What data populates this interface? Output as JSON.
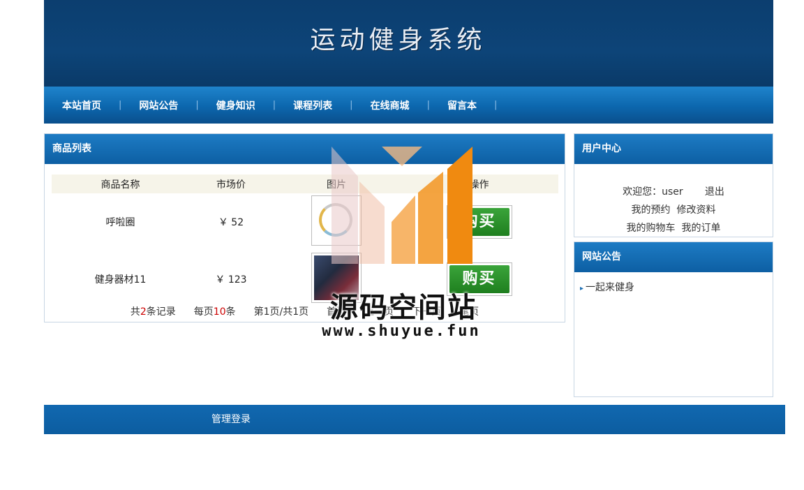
{
  "header": {
    "title": "运动健身系统"
  },
  "nav": {
    "items": [
      "本站首页",
      "网站公告",
      "健身知识",
      "课程列表",
      "在线商城",
      "留言本"
    ]
  },
  "goods_panel": {
    "title": "商品列表",
    "columns": [
      "商品名称",
      "市场价",
      "图片",
      "操作"
    ],
    "rows": [
      {
        "name": "呼啦圈",
        "price": "￥ 52",
        "buy": "购买"
      },
      {
        "name": "健身器材11",
        "price": "￥ 123",
        "buy": "购买"
      }
    ],
    "pager": {
      "total_prefix": "共",
      "total": "2",
      "total_suffix": "条记录",
      "per_prefix": "每页",
      "per": "10",
      "per_suffix": "条",
      "page_info": "第1页/共1页",
      "first": "首页",
      "prev": "上一页",
      "next": "下一页",
      "last": "尾页"
    }
  },
  "user_panel": {
    "title": "用户中心",
    "welcome_label": "欢迎您：",
    "username": "user",
    "logout": "退出",
    "my_booking": "我的预约",
    "edit_profile": "修改资料",
    "my_cart": "我的购物车",
    "my_orders": "我的订单"
  },
  "notice_panel": {
    "title": "网站公告",
    "items": [
      "一起来健身"
    ]
  },
  "footer": {
    "admin_login": "管理登录"
  },
  "watermark": {
    "name": "源码空间站",
    "url": "www.shuyue.fun"
  },
  "colors": {
    "header_bg": "#0d4478",
    "nav_bg": "#0c66ad",
    "accent_green": "#2a922a",
    "price_red": "#cc0000"
  }
}
